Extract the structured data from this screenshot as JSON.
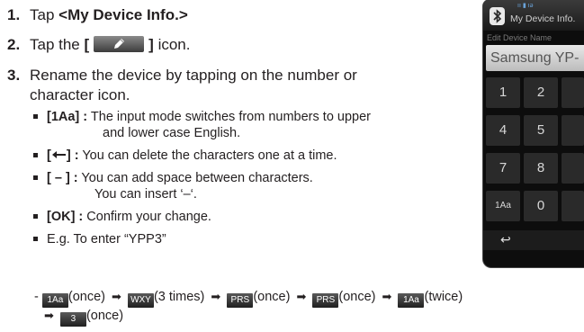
{
  "steps": [
    {
      "num": "1.",
      "text": "Tap ",
      "bold": "<My Device Info.>",
      "after": "."
    },
    {
      "num": "2.",
      "text": "Tap the ",
      "bold_open": "[",
      "bold_close": "]",
      "after": " icon."
    },
    {
      "num": "3.",
      "text": "Rename the device by tapping on the number or",
      "cont": "character icon."
    }
  ],
  "bullets": [
    {
      "key": "[1Aa] :",
      "text": "The input mode switches from numbers to upper",
      "cont": "and lower case English."
    },
    {
      "key": "[",
      "key_end": "] :",
      "text": "You can delete the characters one at a time."
    },
    {
      "key": "[ – ] :",
      "text": "You can add space between characters.",
      "cont": "You can insert ‘–‘."
    },
    {
      "key": "[OK] :",
      "text": "Confirm your change."
    },
    {
      "key": "",
      "text": "E.g. To enter “YPP3”"
    }
  ],
  "example": {
    "dash": "-",
    "sequence": [
      {
        "key": "1Aa",
        "note": "(once)"
      },
      {
        "key": "WXY",
        "note": "(3 times)"
      },
      {
        "key": "PRS",
        "note": "(once)"
      },
      {
        "key": "PRS",
        "note": "(once)"
      },
      {
        "key": "1Aa",
        "note": "(twice)"
      },
      {
        "key": "3",
        "note": "(once)"
      }
    ]
  },
  "device": {
    "title": "My Device Info.",
    "indicator": "ıı  ▮          ıǝ",
    "sub_label": "Edit Device Name",
    "field_value": "Samsung YP-",
    "keys": [
      "1",
      "2",
      "4",
      "5",
      "7",
      "8",
      "1Aa",
      "0"
    ],
    "back_symbol": "↩"
  },
  "icons": [
    "pencil-icon",
    "bluetooth-icon",
    "arrow-right-icon",
    "backspace-icon",
    "back-icon"
  ]
}
